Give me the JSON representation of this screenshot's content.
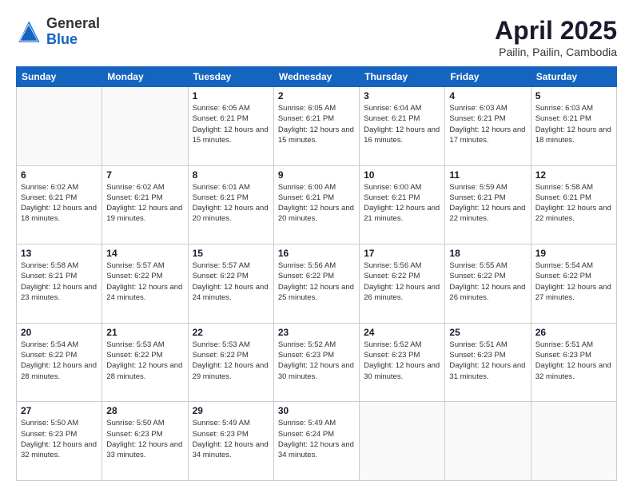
{
  "header": {
    "logo_line1": "General",
    "logo_line2": "Blue",
    "month_title": "April 2025",
    "location": "Pailin, Pailin, Cambodia"
  },
  "weekdays": [
    "Sunday",
    "Monday",
    "Tuesday",
    "Wednesday",
    "Thursday",
    "Friday",
    "Saturday"
  ],
  "weeks": [
    [
      {
        "day": "",
        "info": ""
      },
      {
        "day": "",
        "info": ""
      },
      {
        "day": "1",
        "info": "Sunrise: 6:05 AM\nSunset: 6:21 PM\nDaylight: 12 hours and 15 minutes."
      },
      {
        "day": "2",
        "info": "Sunrise: 6:05 AM\nSunset: 6:21 PM\nDaylight: 12 hours and 15 minutes."
      },
      {
        "day": "3",
        "info": "Sunrise: 6:04 AM\nSunset: 6:21 PM\nDaylight: 12 hours and 16 minutes."
      },
      {
        "day": "4",
        "info": "Sunrise: 6:03 AM\nSunset: 6:21 PM\nDaylight: 12 hours and 17 minutes."
      },
      {
        "day": "5",
        "info": "Sunrise: 6:03 AM\nSunset: 6:21 PM\nDaylight: 12 hours and 18 minutes."
      }
    ],
    [
      {
        "day": "6",
        "info": "Sunrise: 6:02 AM\nSunset: 6:21 PM\nDaylight: 12 hours and 18 minutes."
      },
      {
        "day": "7",
        "info": "Sunrise: 6:02 AM\nSunset: 6:21 PM\nDaylight: 12 hours and 19 minutes."
      },
      {
        "day": "8",
        "info": "Sunrise: 6:01 AM\nSunset: 6:21 PM\nDaylight: 12 hours and 20 minutes."
      },
      {
        "day": "9",
        "info": "Sunrise: 6:00 AM\nSunset: 6:21 PM\nDaylight: 12 hours and 20 minutes."
      },
      {
        "day": "10",
        "info": "Sunrise: 6:00 AM\nSunset: 6:21 PM\nDaylight: 12 hours and 21 minutes."
      },
      {
        "day": "11",
        "info": "Sunrise: 5:59 AM\nSunset: 6:21 PM\nDaylight: 12 hours and 22 minutes."
      },
      {
        "day": "12",
        "info": "Sunrise: 5:58 AM\nSunset: 6:21 PM\nDaylight: 12 hours and 22 minutes."
      }
    ],
    [
      {
        "day": "13",
        "info": "Sunrise: 5:58 AM\nSunset: 6:21 PM\nDaylight: 12 hours and 23 minutes."
      },
      {
        "day": "14",
        "info": "Sunrise: 5:57 AM\nSunset: 6:22 PM\nDaylight: 12 hours and 24 minutes."
      },
      {
        "day": "15",
        "info": "Sunrise: 5:57 AM\nSunset: 6:22 PM\nDaylight: 12 hours and 24 minutes."
      },
      {
        "day": "16",
        "info": "Sunrise: 5:56 AM\nSunset: 6:22 PM\nDaylight: 12 hours and 25 minutes."
      },
      {
        "day": "17",
        "info": "Sunrise: 5:56 AM\nSunset: 6:22 PM\nDaylight: 12 hours and 26 minutes."
      },
      {
        "day": "18",
        "info": "Sunrise: 5:55 AM\nSunset: 6:22 PM\nDaylight: 12 hours and 26 minutes."
      },
      {
        "day": "19",
        "info": "Sunrise: 5:54 AM\nSunset: 6:22 PM\nDaylight: 12 hours and 27 minutes."
      }
    ],
    [
      {
        "day": "20",
        "info": "Sunrise: 5:54 AM\nSunset: 6:22 PM\nDaylight: 12 hours and 28 minutes."
      },
      {
        "day": "21",
        "info": "Sunrise: 5:53 AM\nSunset: 6:22 PM\nDaylight: 12 hours and 28 minutes."
      },
      {
        "day": "22",
        "info": "Sunrise: 5:53 AM\nSunset: 6:22 PM\nDaylight: 12 hours and 29 minutes."
      },
      {
        "day": "23",
        "info": "Sunrise: 5:52 AM\nSunset: 6:23 PM\nDaylight: 12 hours and 30 minutes."
      },
      {
        "day": "24",
        "info": "Sunrise: 5:52 AM\nSunset: 6:23 PM\nDaylight: 12 hours and 30 minutes."
      },
      {
        "day": "25",
        "info": "Sunrise: 5:51 AM\nSunset: 6:23 PM\nDaylight: 12 hours and 31 minutes."
      },
      {
        "day": "26",
        "info": "Sunrise: 5:51 AM\nSunset: 6:23 PM\nDaylight: 12 hours and 32 minutes."
      }
    ],
    [
      {
        "day": "27",
        "info": "Sunrise: 5:50 AM\nSunset: 6:23 PM\nDaylight: 12 hours and 32 minutes."
      },
      {
        "day": "28",
        "info": "Sunrise: 5:50 AM\nSunset: 6:23 PM\nDaylight: 12 hours and 33 minutes."
      },
      {
        "day": "29",
        "info": "Sunrise: 5:49 AM\nSunset: 6:23 PM\nDaylight: 12 hours and 34 minutes."
      },
      {
        "day": "30",
        "info": "Sunrise: 5:49 AM\nSunset: 6:24 PM\nDaylight: 12 hours and 34 minutes."
      },
      {
        "day": "",
        "info": ""
      },
      {
        "day": "",
        "info": ""
      },
      {
        "day": "",
        "info": ""
      }
    ]
  ]
}
